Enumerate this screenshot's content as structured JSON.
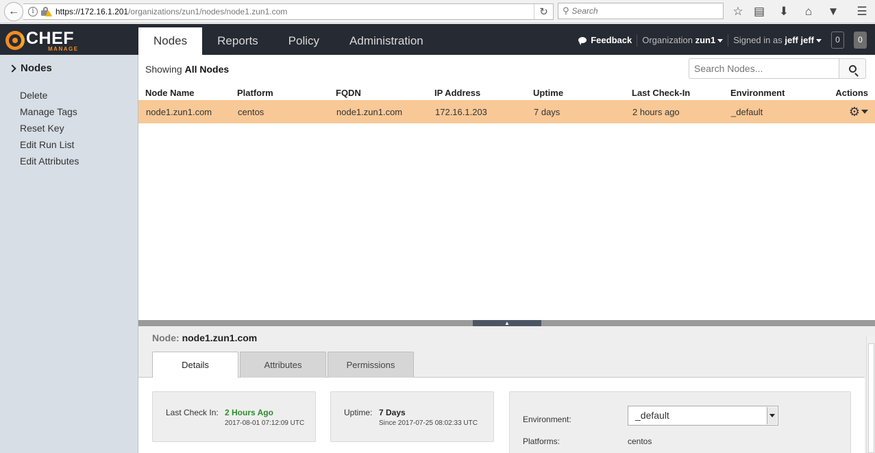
{
  "browser": {
    "url_host": "https://172.16.1.201",
    "url_path": "/organizations/zun1/nodes/node1.zun1.com",
    "search_placeholder": "Search"
  },
  "logo": {
    "text": "CHEF",
    "sub": "MANAGE"
  },
  "nav": {
    "tabs": [
      {
        "label": "Nodes",
        "active": true
      },
      {
        "label": "Reports"
      },
      {
        "label": "Policy"
      },
      {
        "label": "Administration"
      }
    ]
  },
  "header": {
    "feedback": "Feedback",
    "org_label": "Organization",
    "org_name": "zun1",
    "signed_in_label": "Signed in as",
    "user": "jeff jeff",
    "count1": "0",
    "count2": "0"
  },
  "sidebar": {
    "title": "Nodes",
    "items": [
      "Delete",
      "Manage Tags",
      "Reset Key",
      "Edit Run List",
      "Edit Attributes"
    ]
  },
  "main": {
    "showing_prefix": "Showing",
    "showing_value": "All Nodes",
    "search_placeholder": "Search Nodes..."
  },
  "table": {
    "headers": [
      "Node Name",
      "Platform",
      "FQDN",
      "IP Address",
      "Uptime",
      "Last Check-In",
      "Environment",
      "Actions"
    ],
    "rows": [
      [
        "node1.zun1.com",
        "centos",
        "node1.zun1.com",
        "172.16.1.203",
        "7 days",
        "2 hours ago",
        "_default"
      ]
    ]
  },
  "detail": {
    "title_label": "Node:",
    "title_value": "node1.zun1.com",
    "tabs": [
      "Details",
      "Attributes",
      "Permissions"
    ],
    "last_checkin_label": "Last Check In:",
    "last_checkin_value": "2 Hours Ago",
    "last_checkin_time": "2017-08-01 07:12:09 UTC",
    "uptime_label": "Uptime:",
    "uptime_value": "7 Days",
    "uptime_since": "Since 2017-07-25 08:02:33 UTC",
    "environment_label": "Environment:",
    "environment_value": "_default",
    "platforms_label": "Platforms:",
    "platforms_value": "centos"
  },
  "colors": {
    "header_bg": "#252a33",
    "chef_orange": "#f18b21",
    "selected_row": "#f8c897",
    "sidebar_bg": "#d7dee6",
    "checkin_green": "#2e8b2e"
  }
}
